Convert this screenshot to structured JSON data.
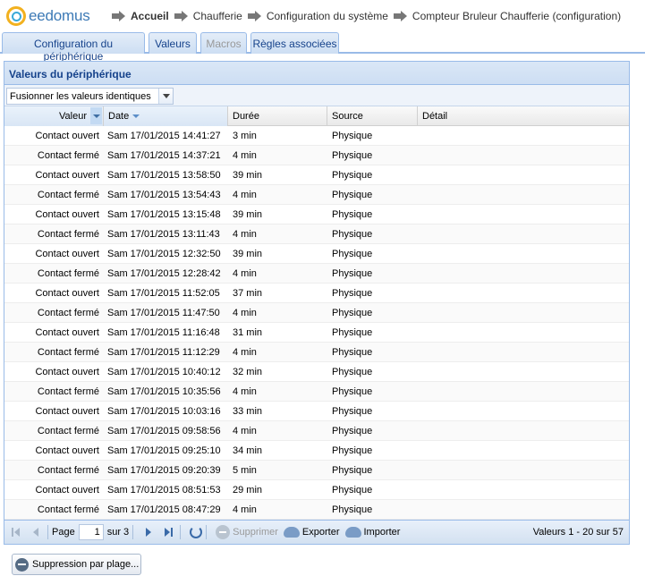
{
  "app": {
    "logo_text": "eedomus"
  },
  "breadcrumb": [
    "Accueil",
    "Chaufferie",
    "Configuration du système",
    "Compteur Bruleur Chaufferie (configuration)"
  ],
  "tabs": [
    {
      "label": "Configuration du périphérique",
      "disabled": false
    },
    {
      "label": "Valeurs",
      "disabled": false
    },
    {
      "label": "Macros",
      "disabled": true
    },
    {
      "label": "Règles associées",
      "disabled": false
    }
  ],
  "panel": {
    "title": "Valeurs du périphérique",
    "grouping": "Fusionner les valeurs identiques"
  },
  "grid": {
    "columns": [
      "Valeur",
      "Date",
      "Durée",
      "Source",
      "Détail"
    ],
    "rows": [
      [
        "Contact ouvert",
        "Sam 17/01/2015 14:41:27",
        "3 min",
        "Physique",
        ""
      ],
      [
        "Contact fermé",
        "Sam 17/01/2015 14:37:21",
        "4 min",
        "Physique",
        ""
      ],
      [
        "Contact ouvert",
        "Sam 17/01/2015 13:58:50",
        "39 min",
        "Physique",
        ""
      ],
      [
        "Contact fermé",
        "Sam 17/01/2015 13:54:43",
        "4 min",
        "Physique",
        ""
      ],
      [
        "Contact ouvert",
        "Sam 17/01/2015 13:15:48",
        "39 min",
        "Physique",
        ""
      ],
      [
        "Contact fermé",
        "Sam 17/01/2015 13:11:43",
        "4 min",
        "Physique",
        ""
      ],
      [
        "Contact ouvert",
        "Sam 17/01/2015 12:32:50",
        "39 min",
        "Physique",
        ""
      ],
      [
        "Contact fermé",
        "Sam 17/01/2015 12:28:42",
        "4 min",
        "Physique",
        ""
      ],
      [
        "Contact ouvert",
        "Sam 17/01/2015 11:52:05",
        "37 min",
        "Physique",
        ""
      ],
      [
        "Contact fermé",
        "Sam 17/01/2015 11:47:50",
        "4 min",
        "Physique",
        ""
      ],
      [
        "Contact ouvert",
        "Sam 17/01/2015 11:16:48",
        "31 min",
        "Physique",
        ""
      ],
      [
        "Contact fermé",
        "Sam 17/01/2015 11:12:29",
        "4 min",
        "Physique",
        ""
      ],
      [
        "Contact ouvert",
        "Sam 17/01/2015 10:40:12",
        "32 min",
        "Physique",
        ""
      ],
      [
        "Contact fermé",
        "Sam 17/01/2015 10:35:56",
        "4 min",
        "Physique",
        ""
      ],
      [
        "Contact ouvert",
        "Sam 17/01/2015 10:03:16",
        "33 min",
        "Physique",
        ""
      ],
      [
        "Contact fermé",
        "Sam 17/01/2015 09:58:56",
        "4 min",
        "Physique",
        ""
      ],
      [
        "Contact ouvert",
        "Sam 17/01/2015 09:25:10",
        "34 min",
        "Physique",
        ""
      ],
      [
        "Contact fermé",
        "Sam 17/01/2015 09:20:39",
        "5 min",
        "Physique",
        ""
      ],
      [
        "Contact ouvert",
        "Sam 17/01/2015 08:51:53",
        "29 min",
        "Physique",
        ""
      ],
      [
        "Contact fermé",
        "Sam 17/01/2015 08:47:29",
        "4 min",
        "Physique",
        ""
      ]
    ]
  },
  "pager": {
    "page_label": "Page",
    "page_value": "1",
    "of_label": "sur 3",
    "delete_label": "Supprimer",
    "export_label": "Exporter",
    "import_label": "Importer",
    "info": "Valeurs 1 - 20 sur 57"
  },
  "bottom": {
    "range_delete_label": "Suppression par plage..."
  }
}
